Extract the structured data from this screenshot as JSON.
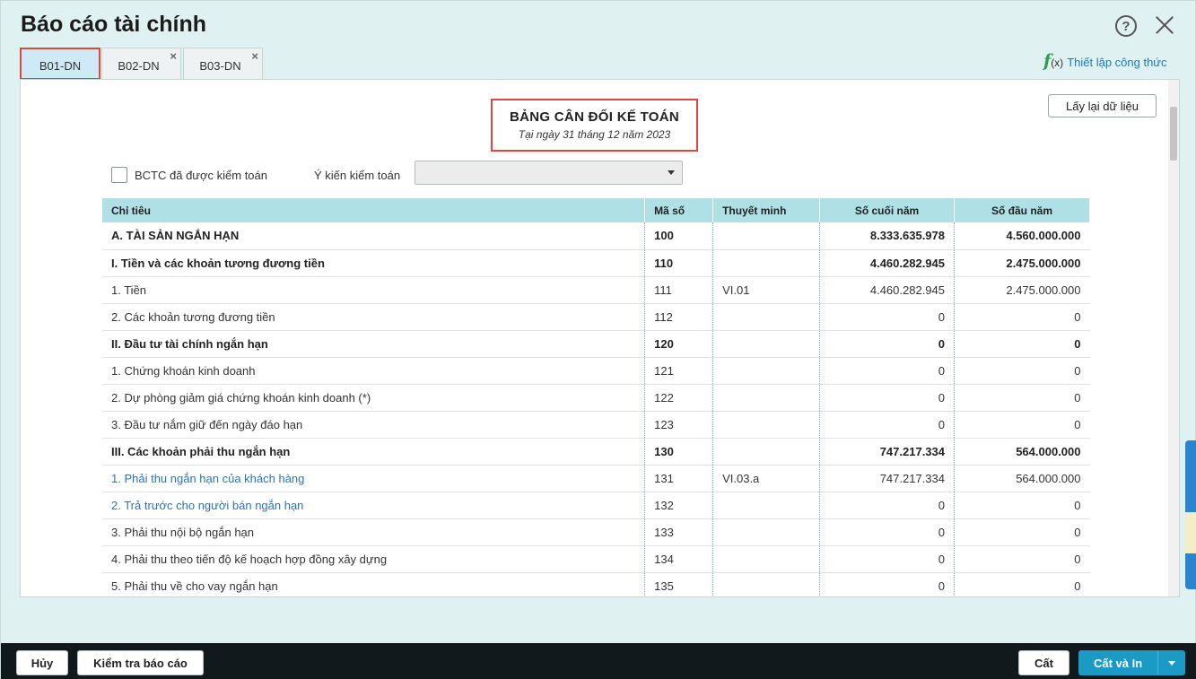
{
  "window": {
    "title": "Báo cáo tài chính",
    "help_glyph": "?"
  },
  "tabs": [
    {
      "label": "B01-DN",
      "active": true
    },
    {
      "label": "B02-DN",
      "close": "×"
    },
    {
      "label": "B03-DN",
      "close": "×"
    }
  ],
  "formula": {
    "f": "f",
    "x": "(x)",
    "label": "Thiết lập công thức"
  },
  "toolbar": {
    "refresh_label": "Lấy lại dữ liệu"
  },
  "report": {
    "title": "BẢNG CÂN ĐỐI KẾ TOÁN",
    "date": "Tại ngày 31 tháng 12 năm 2023"
  },
  "filters": {
    "audited_label": "BCTC đã được kiểm toán",
    "opinion_label": "Ý kiến kiểm toán",
    "opinion_value": ""
  },
  "table": {
    "headers": [
      "Chỉ tiêu",
      "Mã số",
      "Thuyết minh",
      "Số cuối năm",
      "Số đầu năm"
    ],
    "rows": [
      {
        "label": "A. TÀI SẢN NGẮN HẠN",
        "code": "100",
        "note": "",
        "end": "8.333.635.978",
        "start": "4.560.000.000",
        "style": "bold"
      },
      {
        "label": "I. Tiền và các khoản tương đương tiền",
        "code": "110",
        "note": "",
        "end": "4.460.282.945",
        "start": "2.475.000.000",
        "style": "bold"
      },
      {
        "label": "1. Tiền",
        "code": "111",
        "note": "VI.01",
        "end": "4.460.282.945",
        "start": "2.475.000.000",
        "style": "normal"
      },
      {
        "label": "2. Các khoản tương đương tiền",
        "code": "112",
        "note": "",
        "end": "0",
        "start": "0",
        "style": "normal"
      },
      {
        "label": "II. Đầu tư tài chính ngắn hạn",
        "code": "120",
        "note": "",
        "end": "0",
        "start": "0",
        "style": "bold"
      },
      {
        "label": "1. Chứng khoán kinh doanh",
        "code": "121",
        "note": "",
        "end": "0",
        "start": "0",
        "style": "normal"
      },
      {
        "label": "2. Dự phòng giảm giá chứng khoán kinh doanh (*)",
        "code": "122",
        "note": "",
        "end": "0",
        "start": "0",
        "style": "normal"
      },
      {
        "label": "3. Đầu tư nắm giữ đến ngày đáo hạn",
        "code": "123",
        "note": "",
        "end": "0",
        "start": "0",
        "style": "normal"
      },
      {
        "label": "III. Các khoản phải thu ngắn hạn",
        "code": "130",
        "note": "",
        "end": "747.217.334",
        "start": "564.000.000",
        "style": "bold"
      },
      {
        "label": "1. Phải thu ngắn hạn của khách hàng",
        "code": "131",
        "note": "VI.03.a",
        "end": "747.217.334",
        "start": "564.000.000",
        "style": "link"
      },
      {
        "label": "2. Trả trước cho người bán ngắn hạn",
        "code": "132",
        "note": "",
        "end": "0",
        "start": "0",
        "style": "link"
      },
      {
        "label": "3. Phải thu nội bộ ngắn hạn",
        "code": "133",
        "note": "",
        "end": "0",
        "start": "0",
        "style": "normal"
      },
      {
        "label": "4. Phải thu theo tiến độ kế hoạch hợp đồng xây dựng",
        "code": "134",
        "note": "",
        "end": "0",
        "start": "0",
        "style": "normal"
      },
      {
        "label": "5. Phải thu về cho vay ngắn hạn",
        "code": "135",
        "note": "",
        "end": "0",
        "start": "0",
        "style": "normal"
      }
    ]
  },
  "footer": {
    "cancel_label": "Hủy",
    "check_label": "Kiểm tra báo cáo",
    "save_label": "Cất",
    "save_print_label": "Cất và In"
  }
}
